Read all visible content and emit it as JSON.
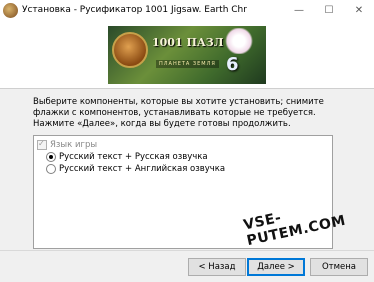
{
  "window": {
    "title": "Установка - Русификатор 1001 Jigsaw. Earth Chr",
    "minimize_glyph": "—",
    "maximize_glyph": "☐",
    "close_glyph": "✕"
  },
  "banner": {
    "title": "1001 ПАЗЛ",
    "subtitle": "ПЛАНЕТА ЗЕМЛЯ",
    "number": "6"
  },
  "instruction": "Выберите компоненты, которые вы хотите установить; снимите флажки с компонентов, устанавливать которые не требуется. Нажмите «Далее», когда вы будете готовы продолжить.",
  "components": {
    "group_label": "Язык игры",
    "options": [
      {
        "label": "Русский текст + Русская озвучка",
        "selected": true
      },
      {
        "label": "Русский текст + Английская озвучка",
        "selected": false
      }
    ]
  },
  "watermark": "VSE-PUTEM.COM",
  "buttons": {
    "back": "< Назад",
    "next": "Далее >",
    "cancel": "Отмена"
  },
  "colors": {
    "accent": "#0078d7",
    "panel_bg": "#ffffff",
    "window_bg": "#f0f0f0"
  }
}
